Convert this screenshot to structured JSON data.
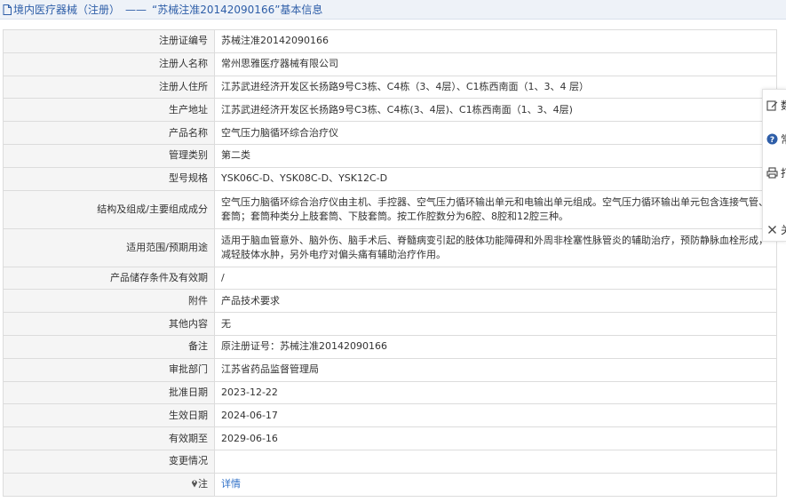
{
  "header": {
    "category": "境内医疗器械（注册）",
    "separator": "——",
    "record_title": "“苏械注准20142090166”基本信息"
  },
  "fields": [
    {
      "label": "注册证编号",
      "value": "苏械注准20142090166"
    },
    {
      "label": "注册人名称",
      "value": "常州思雅医疗器械有限公司"
    },
    {
      "label": "注册人住所",
      "value": "江苏武进经济开发区长扬路9号C3栋、C4栋（3、4层）、C1栋西南面（1、3、4 层）"
    },
    {
      "label": "生产地址",
      "value": "江苏武进经济开发区长扬路9号C3栋、C4栋(3、4层)、C1栋西南面（1、3、4层)"
    },
    {
      "label": "产品名称",
      "value": "空气压力脑循环综合治疗仪"
    },
    {
      "label": "管理类别",
      "value": "第二类"
    },
    {
      "label": "型号规格",
      "value": "YSK06C-D、YSK08C-D、YSK12C-D"
    },
    {
      "label": "结构及组成/主要组成成分",
      "value": "空气压力脑循环综合治疗仪由主机、手控器、空气压力循环输出单元和电输出单元组成。空气压力循环输出单元包含连接气管、套筒；套筒种类分上肢套筒、下肢套筒。按工作腔数分为6腔、8腔和12腔三种。"
    },
    {
      "label": "适用范围/预期用途",
      "value": "适用于脑血管意外、脑外伤、脑手术后、脊髓病变引起的肢体功能障碍和外周非栓塞性脉管炎的辅助治疗，预防静脉血栓形成，减轻肢体水肿，另外电疗对偏头痛有辅助治疗作用。"
    },
    {
      "label": "产品储存条件及有效期",
      "value": "/"
    },
    {
      "label": "附件",
      "value": "产品技术要求"
    },
    {
      "label": "其他内容",
      "value": "无"
    },
    {
      "label": "备注",
      "value": "原注册证号：苏械注准20142090166"
    },
    {
      "label": "审批部门",
      "value": "江苏省药品监督管理局"
    },
    {
      "label": "批准日期",
      "value": "2023-12-22"
    },
    {
      "label": "生效日期",
      "value": "2024-06-17"
    },
    {
      "label": "有效期至",
      "value": "2029-06-16"
    },
    {
      "label": "变更情况",
      "value": ""
    }
  ],
  "note": {
    "label": "注",
    "link_text": "详情"
  },
  "side_panel": {
    "items": [
      {
        "icon": "edit-icon",
        "text": "数"
      },
      {
        "icon": "help-icon",
        "text": "常"
      },
      {
        "icon": "print-icon",
        "text": "打"
      },
      {
        "icon": "close-icon",
        "text": "关"
      }
    ]
  }
}
